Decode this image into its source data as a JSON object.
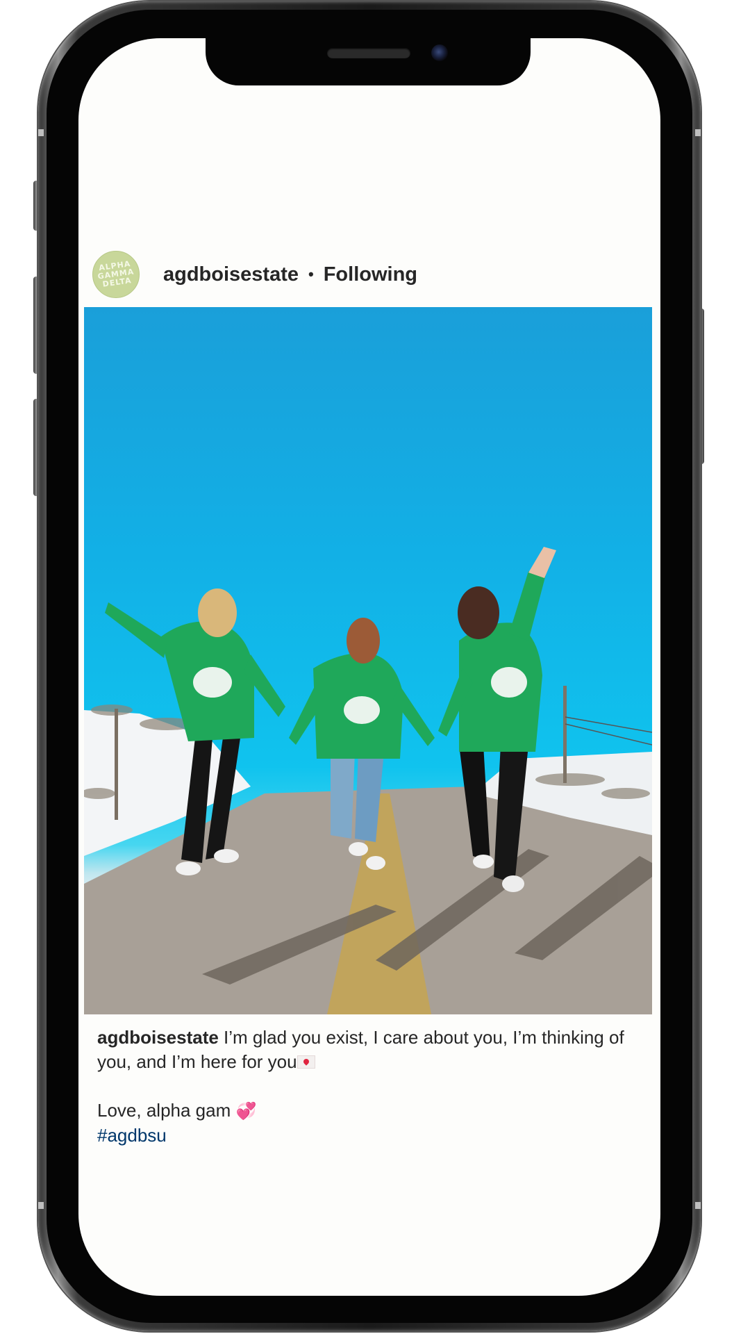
{
  "post": {
    "username": "agdboisestate",
    "separator": "•",
    "follow_status": "Following",
    "avatar_text": "ALPHA GAMMA DELTA"
  },
  "caption": {
    "username": "agdboisestate",
    "line1": " I’m glad you exist, I care about you, I’m thinking of you, and I’m here for you",
    "line2": "Love, alpha gam ",
    "heart_emoji": "💞",
    "hashtag": "#agdbsu"
  },
  "colors": {
    "text": "#262626",
    "hashtag": "#00376b",
    "avatar_bg": "#c8d79a",
    "sweatshirt": "#1fa85a",
    "sky": "#12b0e6"
  },
  "icons": [
    "envelope-heart-emoji",
    "two-hearts-emoji"
  ]
}
